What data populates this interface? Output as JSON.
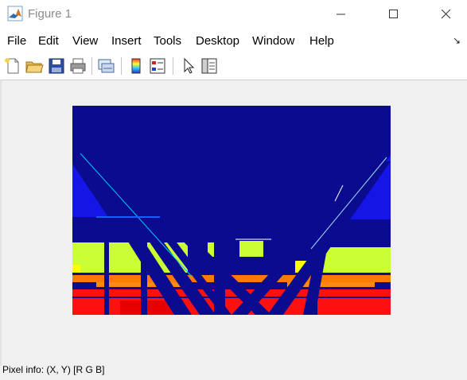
{
  "window": {
    "title": "Figure 1",
    "controls": {
      "minimize": "minimize-icon",
      "maximize": "maximize-icon",
      "close": "close-icon"
    }
  },
  "menubar": {
    "items": [
      "File",
      "Edit",
      "View",
      "Insert",
      "Tools",
      "Desktop",
      "Window",
      "Help"
    ],
    "collapse_glyph": "↘"
  },
  "toolbar": {
    "buttons": [
      "new-figure-icon",
      "open-file-icon",
      "save-icon",
      "print-icon",
      "link-plot-icon",
      "insert-colorbar-icon",
      "insert-legend-icon",
      "select-arrow-icon",
      "property-inspector-icon"
    ]
  },
  "figure": {
    "content": "jet-colormap image of a steel truss structure",
    "colors": {
      "background": "#0b0b8f",
      "blue": "#1515e6",
      "cyan": "#00c8ff",
      "yellow_green": "#ccff33",
      "yellow": "#ffff00",
      "orange": "#ff7a00",
      "red": "#ff1010"
    }
  },
  "status": {
    "pixel_info": "Pixel info: (X, Y)  [R G B]"
  }
}
